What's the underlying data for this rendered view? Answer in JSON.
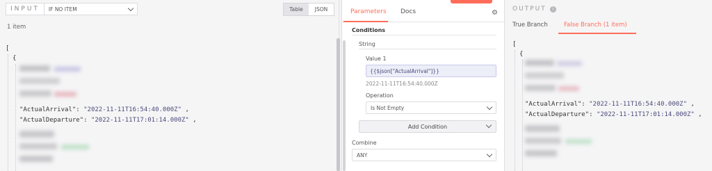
{
  "input": {
    "label": "INPUT",
    "item_select": "IF NO ITEM",
    "view_table": "Table",
    "view_json": "JSON",
    "item_count": "1 item",
    "json": {
      "open_bracket": "[",
      "open_brace": "{",
      "key_arrival": "\"ActualArrival\"",
      "val_arrival": "\"2022-11-11T16:54:40.000Z\"",
      "key_departure": "\"ActualDeparture\"",
      "val_departure": "\"2022-11-11T17:01:14.000Z\"",
      "colon": ":",
      "comma": ","
    }
  },
  "params": {
    "tab_parameters": "Parameters",
    "tab_docs": "Docs",
    "conditions_title": "Conditions",
    "string_title": "String",
    "value1_label": "Value 1",
    "value1_value": "{{$json[\"ActualArrival\"]}}",
    "value1_hint": "2022-11-11T16:54:40.000Z",
    "operation_label": "Operation",
    "operation_value": "Is Not Empty",
    "add_condition": "Add Condition",
    "combine_label": "Combine",
    "combine_value": "ANY"
  },
  "output": {
    "title": "OUTPUT",
    "tab_true": "True Branch",
    "tab_false": "False Branch (1 item)",
    "json": {
      "open_bracket": "[",
      "open_brace": "{",
      "key_arrival": "\"ActualArrival\"",
      "val_arrival": "\"2022-11-11T16:54:40.000Z\"",
      "key_departure": "\"ActualDeparture\"",
      "val_departure": "\"2022-11-11T17:01:14.000Z\"",
      "colon": ":",
      "comma": ","
    }
  },
  "colors": {
    "accent": "#ff6d5a",
    "panel_bg": "#f5f5f6",
    "expression_bg": "#eceef8"
  },
  "icons": [
    "chevron-down-icon",
    "gear-icon",
    "info-icon"
  ]
}
